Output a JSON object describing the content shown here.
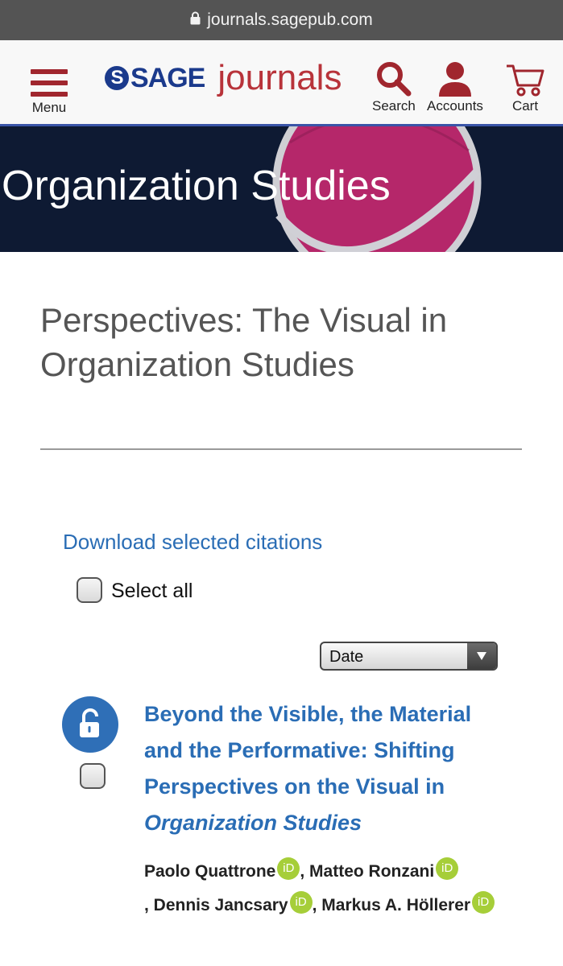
{
  "browser": {
    "url": "journals.sagepub.com"
  },
  "header": {
    "menu_label": "Menu",
    "brand_sage": "SAGE",
    "brand_journals": "journals",
    "search_label": "Search",
    "accounts_label": "Accounts",
    "cart_label": "Cart",
    "colors": {
      "brand_red": "#a0262e",
      "brand_blue": "#1b3a8c",
      "header_border": "#3a55a8"
    }
  },
  "banner": {
    "journal_title": "Organization Studies",
    "colors": {
      "background": "#0e1a33",
      "circle": "#b5276a"
    }
  },
  "main": {
    "page_title": "Perspectives: The Visual in Organization Studies",
    "download_link": "Download selected citations",
    "select_all_label": "Select all",
    "sort_select": {
      "selected": "Date"
    }
  },
  "articles": [
    {
      "access": "open-access-icon",
      "title_plain": "Beyond the Visible, the Material and the Performative: Shifting Perspectives on the Visual in ",
      "title_italic": "Organization Studies",
      "authors": [
        {
          "name": "Paolo Quattrone",
          "orcid": "iD"
        },
        {
          "name": "Matteo Ronzani",
          "orcid": "iD"
        },
        {
          "name": "Dennis Jancsary",
          "orcid": "iD"
        },
        {
          "name": "Markus A. Höllerer",
          "orcid": "iD"
        }
      ]
    }
  ]
}
